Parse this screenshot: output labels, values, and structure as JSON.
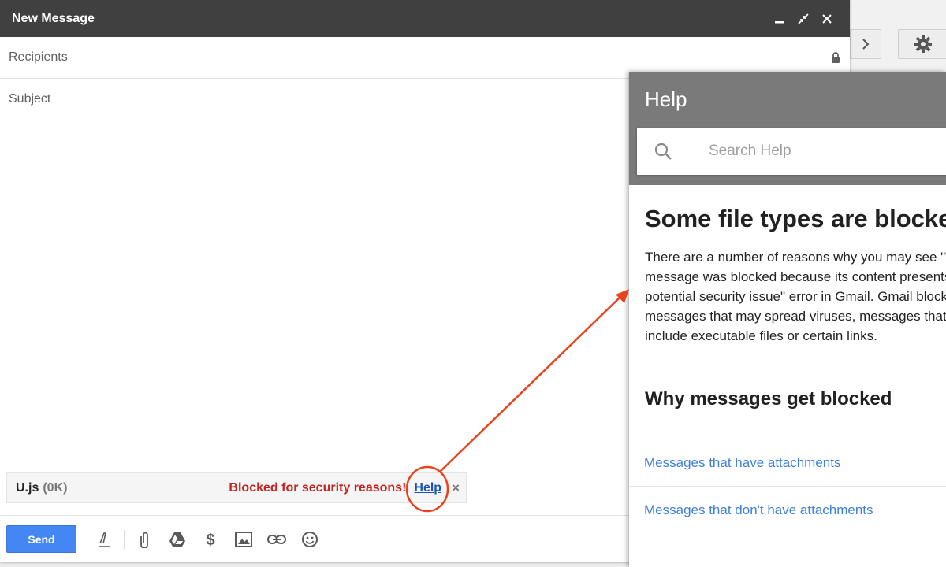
{
  "compose": {
    "title": "New Message",
    "recipients_placeholder": "Recipients",
    "subject_placeholder": "Subject",
    "send_label": "Send"
  },
  "attachment": {
    "file_name": "U.js",
    "file_size": "(0K)",
    "status": "Blocked for security reasons!",
    "help_link": "Help",
    "close_glyph": "×"
  },
  "help_panel": {
    "title": "Help",
    "search_placeholder": "Search Help",
    "article_title": "Some file types are blocked",
    "article_text": "There are a number of reasons why you may see \"This message was blocked because its content presents a potential security issue\" error in Gmail. Gmail blocks messages that may spread viruses, messages that include executable files or certain links.",
    "section_title": "Why messages get blocked",
    "links": [
      "Messages that have attachments",
      "Messages that don't have attachments"
    ]
  },
  "colors": {
    "compose_header": "#404040",
    "send_button": "#4487f4",
    "blocked_text": "#c5221f",
    "help_link": "#1a53b3",
    "help_header": "#7a7a7a",
    "annotation": "#e8431d"
  },
  "icons": [
    "minimize-icon",
    "expand-icon",
    "close-icon",
    "lock-icon",
    "formatting-icon",
    "attach-icon",
    "drive-icon",
    "money-icon",
    "photo-icon",
    "link-icon",
    "emoji-icon",
    "search-icon",
    "chevron-right-icon",
    "gear-icon"
  ]
}
